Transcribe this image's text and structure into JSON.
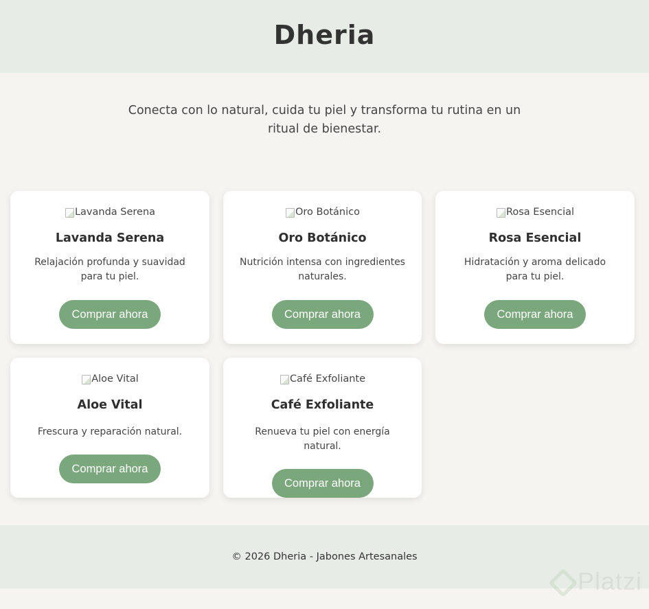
{
  "header": {
    "title": "Dheria"
  },
  "tagline": "Conecta con lo natural, cuida tu piel y transforma tu rutina en un ritual de bienestar.",
  "products": [
    {
      "image_alt": "Lavanda Serena",
      "name": "Lavanda Serena",
      "description": "Relajación profunda y suavidad para tu piel.",
      "button_label": "Comprar ahora"
    },
    {
      "image_alt": "Oro Botánico",
      "name": "Oro Botánico",
      "description": "Nutrición intensa con ingredientes naturales.",
      "button_label": "Comprar ahora"
    },
    {
      "image_alt": "Rosa Esencial",
      "name": "Rosa Esencial",
      "description": "Hidratación y aroma delicado para tu piel.",
      "button_label": "Comprar ahora"
    },
    {
      "image_alt": "Aloe Vital",
      "name": "Aloe Vital",
      "description": "Frescura y reparación natural.",
      "button_label": "Comprar ahora"
    },
    {
      "image_alt": "Café Exfoliante",
      "name": "Café Exfoliante",
      "description": "Renueva tu piel con energía natural.",
      "button_label": "Comprar ahora"
    }
  ],
  "footer": {
    "text": "© 2026 Dheria - Jabones Artesanales"
  },
  "watermark": {
    "text": "Platzi"
  },
  "colors": {
    "header_bg": "#e7ede6",
    "page_bg": "#f6f4f0",
    "button_bg": "#7aa77b",
    "card_bg": "#ffffff"
  }
}
